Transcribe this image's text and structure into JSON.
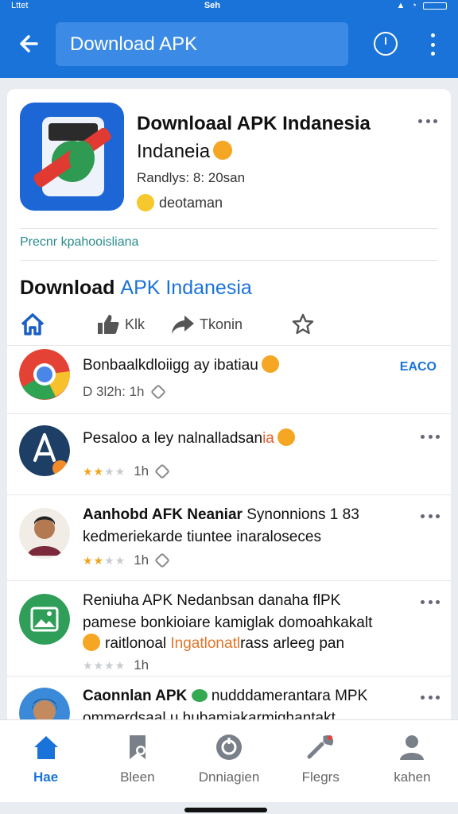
{
  "status": {
    "left": "Lttet",
    "time": "Seh"
  },
  "toolbar": {
    "search_value": "Download APK"
  },
  "app": {
    "title_line1": "Downloaal APK Indanesia",
    "title_line2": "Indaneia",
    "meta": "Randlys: 8: 20san",
    "developer": "deotaman"
  },
  "promo": "Precnr kpahooisliana",
  "section": {
    "title_black": "Download",
    "title_accent": "APK Indanesia"
  },
  "actions": [
    {
      "label": "",
      "icon": "home-icon"
    },
    {
      "label": "Klk",
      "icon": "thumbs-up-icon"
    },
    {
      "label": "Tkonin",
      "icon": "share-icon"
    },
    {
      "label": "",
      "icon": "star-icon"
    }
  ],
  "items": [
    {
      "title": "Bonbaalkdloiigg ay ibatiau",
      "sub": "D 3l2h: 1h",
      "tag": "EACO",
      "rating": 0,
      "icon": "chrome-like-icon"
    },
    {
      "title": "Pesaloo a ley nalnalladsan",
      "title_tail": "ia",
      "sub": "1h",
      "rating": 2,
      "icon": "pushbullet-like-icon"
    },
    {
      "title": "Aanhobd AFK Neaniar",
      "title_b": "Synonnions 1 83",
      "line2": "kedmeriekarde tiuntee inaraloseces",
      "sub": "1h",
      "rating": 2,
      "icon": "person-avatar"
    },
    {
      "title": "Reniuha APK Nedanbsan",
      "title_b": "danaha flPK",
      "line2": "pamese bonkioiare kamiglak domoahkakalt",
      "line3_a": "raitlonoal",
      "line3_b": "Ingatlonatl",
      "line3_c": "rass arleeg pan",
      "sub": "1h",
      "rating": 0,
      "icon": "image-app-icon"
    },
    {
      "title": "Caonnlan APK",
      "title_b": "nudddamerantara MPK",
      "line2": "ommerdsaal u hubamiakarmighantakt",
      "sub": "",
      "rating": 0,
      "icon": "person-avatar-2"
    }
  ],
  "nav": [
    {
      "label": "Hae",
      "icon": "home-icon",
      "active": true
    },
    {
      "label": "Bleen",
      "icon": "bookmark-icon",
      "active": false
    },
    {
      "label": "Dnniagien",
      "icon": "download-icon",
      "active": false
    },
    {
      "label": "Flegrs",
      "icon": "wrench-icon",
      "active": false
    },
    {
      "label": "kahen",
      "icon": "person-icon",
      "active": false
    }
  ],
  "colors": {
    "primary": "#1a73d8",
    "accent_teal": "#2a8c8c",
    "star": "#f2a31b"
  }
}
